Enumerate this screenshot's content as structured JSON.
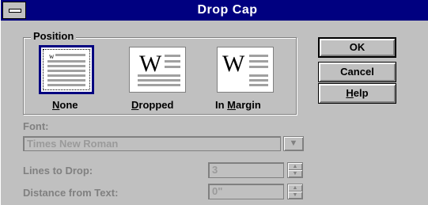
{
  "window": {
    "title": "Drop Cap"
  },
  "position_group": {
    "label": "Position",
    "options": [
      {
        "label_ul": "N",
        "label_rest": "one",
        "selected": true
      },
      {
        "label_ul": "D",
        "label_rest": "ropped",
        "selected": false
      },
      {
        "label_pre": "In ",
        "label_ul": "M",
        "label_rest": "argin",
        "selected": false
      }
    ],
    "preview_letter": "W",
    "small_preview_letter": "w"
  },
  "buttons": {
    "ok": "OK",
    "cancel": "Cancel",
    "help_ul": "H",
    "help_rest": "elp"
  },
  "font": {
    "label": "Font:",
    "value": "Times New Roman",
    "enabled": false
  },
  "lines_to_drop": {
    "label": "Lines to Drop:",
    "value": "3",
    "enabled": false
  },
  "distance_from_text": {
    "label": "Distance from Text:",
    "value": "0\"",
    "enabled": false
  },
  "colors": {
    "titlebar": "#000080",
    "face": "#c0c0c0",
    "disabled_text": "#808080"
  }
}
